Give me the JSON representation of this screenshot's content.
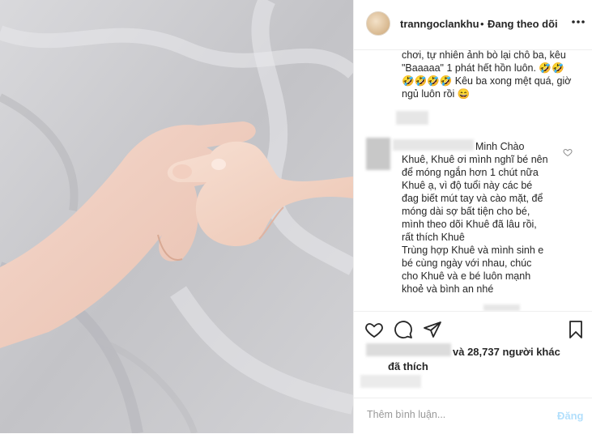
{
  "header": {
    "username": "tranngoclankhu",
    "bullet": "•",
    "follow_status": "Đang theo dõi",
    "more_label": "..."
  },
  "caption": {
    "lines": [
      "chơi, tự nhiên ảnh bò lại chỗ ba, kêu",
      "\"Baaaaa\" 1 phát hết hồn luôn. 🤣🤣",
      "🤣🤣🤣🤣 Kêu ba xong mệt quá, giờ",
      "ngủ luôn rồi 😄"
    ]
  },
  "comment": {
    "first_line": "Minh Chào",
    "lines": [
      "Khuê, Khuê ơi mình nghĩ bé nên",
      "để móng ngắn hơn 1 chút nữa",
      "Khuê ạ, vì độ tuổi này các bé",
      "đag biết mút tay và cào mặt, để",
      "móng dài sợ bất tiện cho bé,",
      "mình theo dõi Khuê đã lâu rồi,",
      "rất thích Khuê",
      "Trùng hợp Khuê và mình sinh e",
      "bé cùng ngày với nhau, chúc",
      "cho Khuê và e bé luôn mạnh",
      "khoẻ và bình an nhé"
    ]
  },
  "likes": {
    "text": "và 28,737 người khác",
    "text2": "đã thích"
  },
  "add_comment": {
    "placeholder": "Thêm bình luận...",
    "post_label": "Đăng"
  },
  "colors": {
    "text": "#262626",
    "divider": "#efefef",
    "post_disabled": "#b2dffc",
    "muted": "#999999"
  },
  "icons": [
    "heart-icon",
    "comment-icon",
    "share-icon",
    "bookmark-icon",
    "more-options-icon"
  ]
}
